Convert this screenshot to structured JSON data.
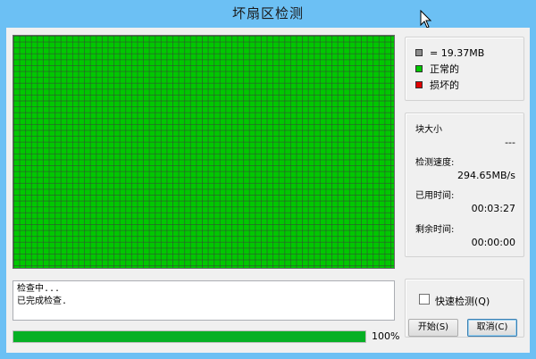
{
  "window": {
    "title": "坏扇区检测"
  },
  "legend": {
    "items": [
      {
        "label": "= 19.37MB",
        "color": "#8c8c8c"
      },
      {
        "label": "正常的",
        "color": "#00c800"
      },
      {
        "label": "损坏的",
        "color": "#e00000"
      }
    ]
  },
  "info": {
    "block_size_label": "块大小",
    "block_size_value": "---",
    "speed_label": "检测速度:",
    "speed_value": "294.65MB/s",
    "elapsed_label": "已用时间:",
    "elapsed_value": "00:03:27",
    "remaining_label": "剩余时间:",
    "remaining_value": "00:00:00"
  },
  "grid": {
    "status": "all-normal",
    "normal_color": "#00c800"
  },
  "log": {
    "lines": [
      "检查中...",
      "已完成检查."
    ]
  },
  "progress": {
    "value": 1.0,
    "label": "100%"
  },
  "quick_check": {
    "label": "快速检测(Q)",
    "checked": false
  },
  "buttons": {
    "start_label": "开始(S)",
    "cancel_label": "取消(C)"
  }
}
